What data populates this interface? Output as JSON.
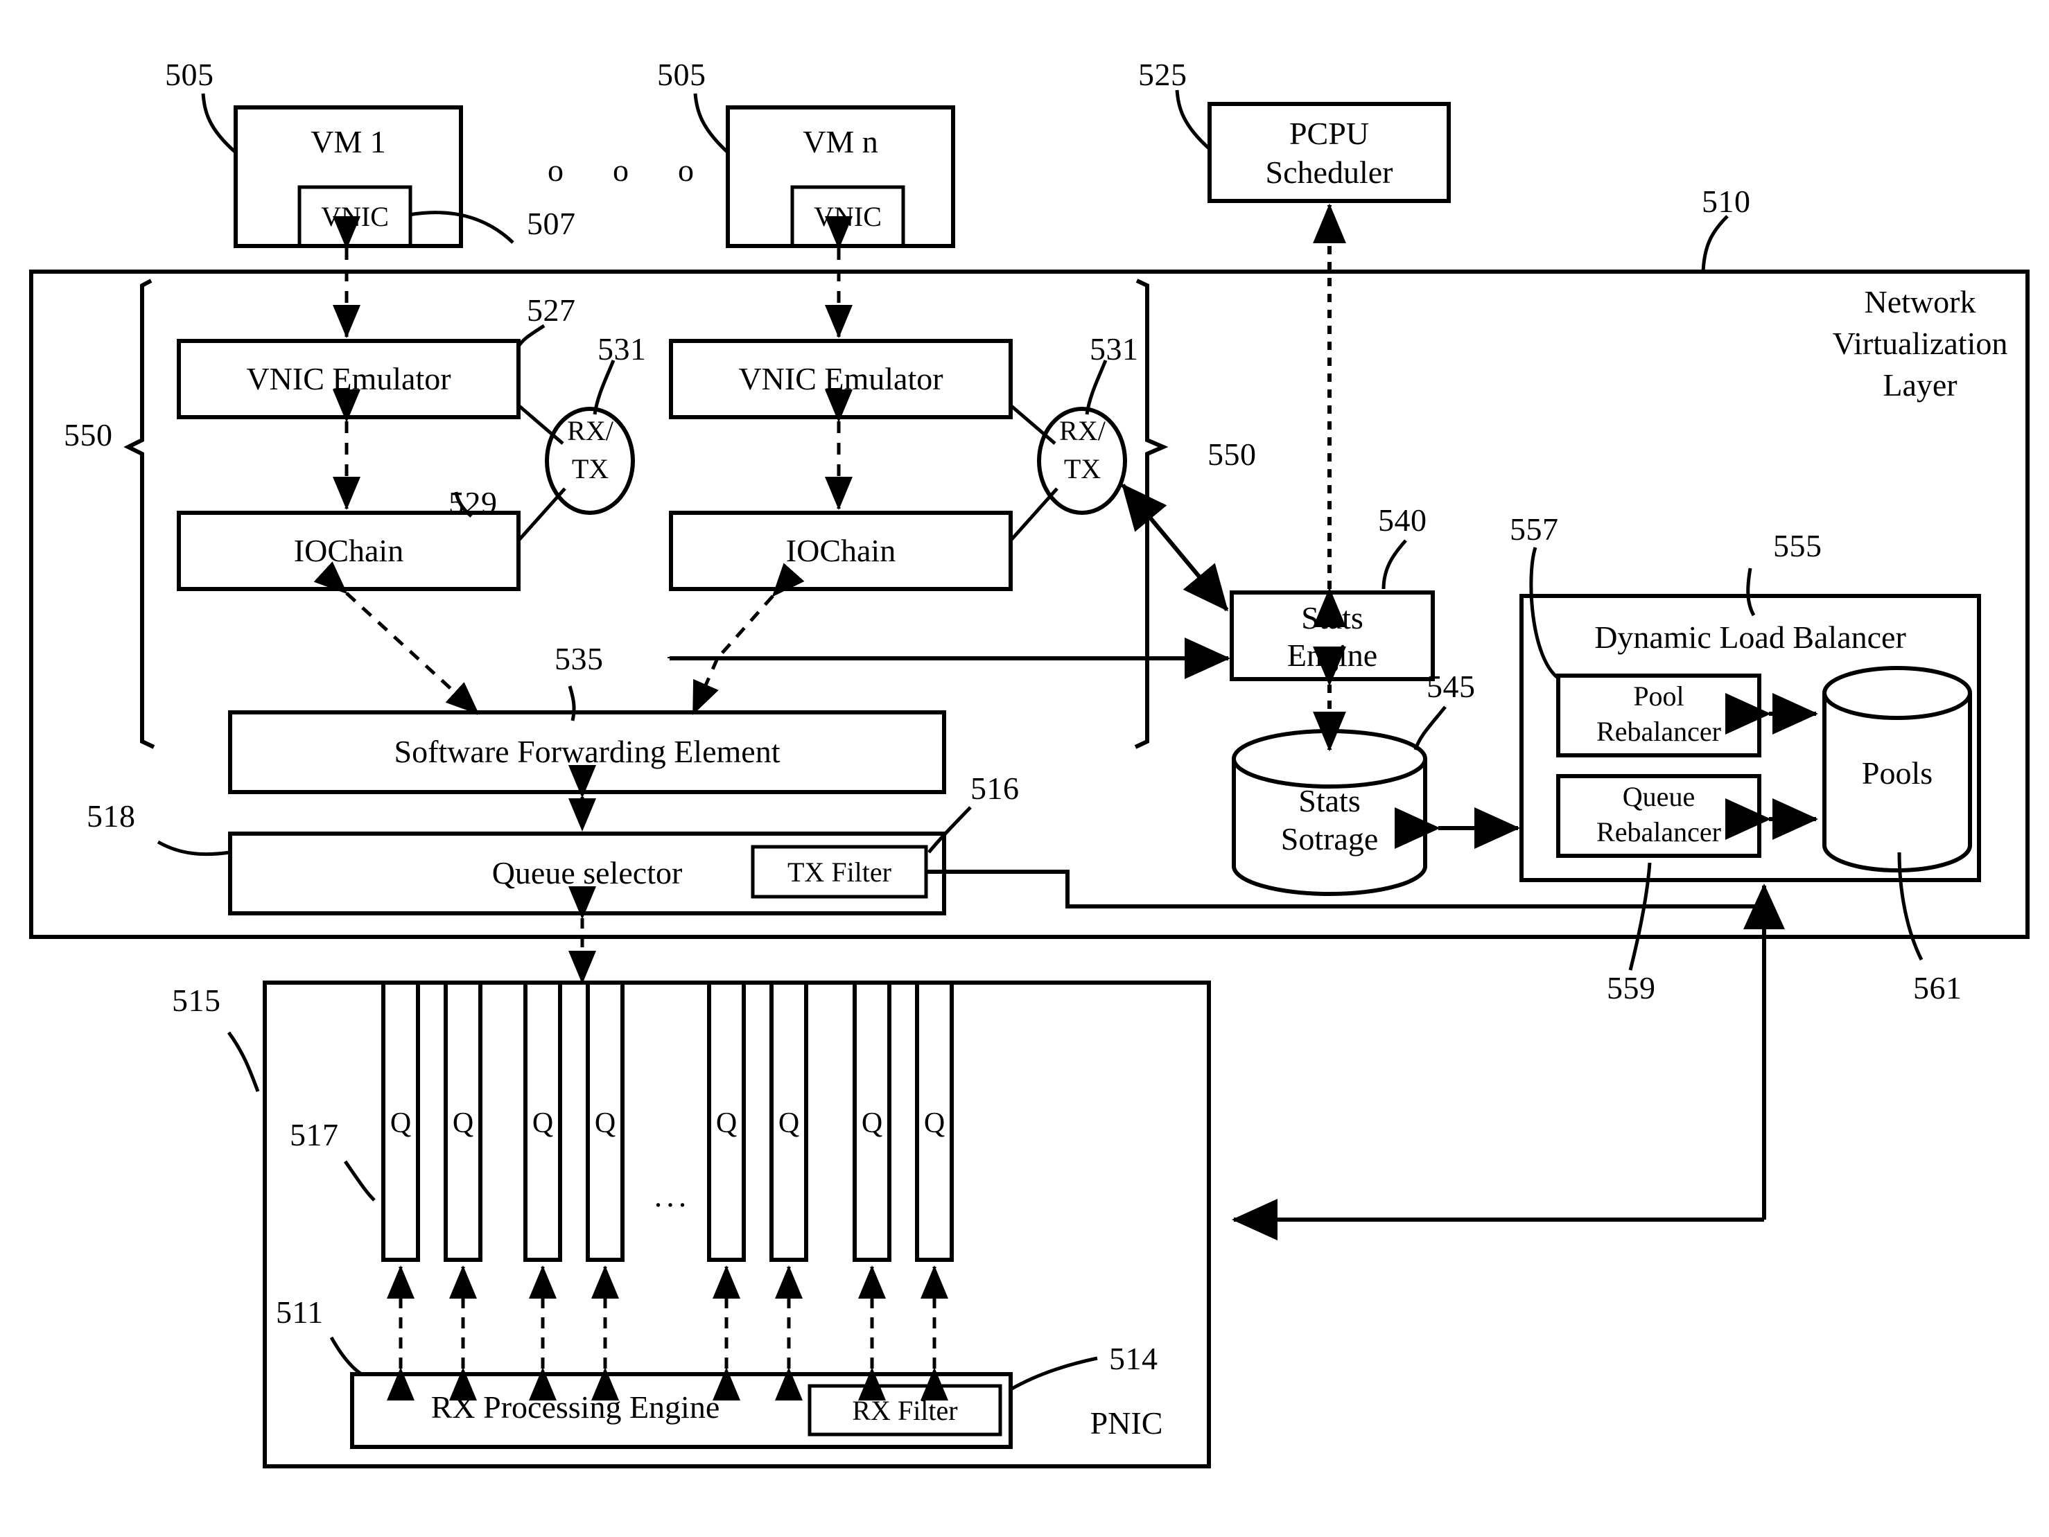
{
  "figure": {
    "type": "patent-block-diagram",
    "domain": "network virtualization architecture"
  },
  "vms": [
    {
      "title": "VM 1",
      "vnic_label": "VNIC",
      "ref": "505",
      "vnic_ref": "507"
    },
    {
      "title": "VM n",
      "vnic_label": "VNIC",
      "ref": "505"
    }
  ],
  "vm_ellipsis": "o  o  o",
  "pcpu_scheduler": {
    "label_line1": "PCPU",
    "label_line2": "Scheduler",
    "ref": "525"
  },
  "virtualization_layer": {
    "title_line1": "Network",
    "title_line2": "Virtualization",
    "title_line3": "Layer",
    "ref": "510"
  },
  "stacks": [
    {
      "emulator": "VNIC Emulator",
      "emulator_ref": "527",
      "iochain": "IOChain",
      "iochain_ref": "529",
      "rxtx_line1": "RX/",
      "rxtx_line2": "TX",
      "rxtx_ref": "531",
      "bracket_ref": "550"
    },
    {
      "emulator": "VNIC Emulator",
      "iochain": "IOChain",
      "rxtx_line1": "RX/",
      "rxtx_line2": "TX",
      "rxtx_ref": "531",
      "bracket_ref": "550"
    }
  ],
  "software_forwarding_element": {
    "label": "Software Forwarding Element",
    "ref": "535"
  },
  "queue_selector": {
    "label": "Queue selector",
    "ref": "518"
  },
  "tx_filter": {
    "label": "TX Filter",
    "ref": "516"
  },
  "stats_engine": {
    "label_line1": "Stats",
    "label_line2": "Engine",
    "ref": "540"
  },
  "stats_storage": {
    "label_line1": "Stats",
    "label_line2": "Sotrage",
    "ref": "545"
  },
  "dynamic_load_balancer": {
    "title": "Dynamic Load Balancer",
    "ref": "555",
    "inner_ref": "557",
    "pool_rebalancer": {
      "label_line1": "Pool",
      "label_line2": "Rebalancer"
    },
    "queue_rebalancer": {
      "label_line1": "Queue",
      "label_line2": "Rebalancer",
      "ref": "559"
    },
    "pools": {
      "label": "Pools",
      "ref": "561"
    }
  },
  "pnic": {
    "label": "PNIC",
    "ref": "515",
    "queue_label": "Q",
    "queue_ref": "517",
    "queue_count_left": 4,
    "queue_count_right": 4,
    "queue_ellipsis": "...",
    "rx_processing_engine": {
      "label": "RX Processing Engine",
      "ref": "511"
    },
    "rx_filter": {
      "label": "RX Filter",
      "ref": "514"
    }
  },
  "colors": {
    "stroke": "#000000",
    "background": "#ffffff"
  }
}
